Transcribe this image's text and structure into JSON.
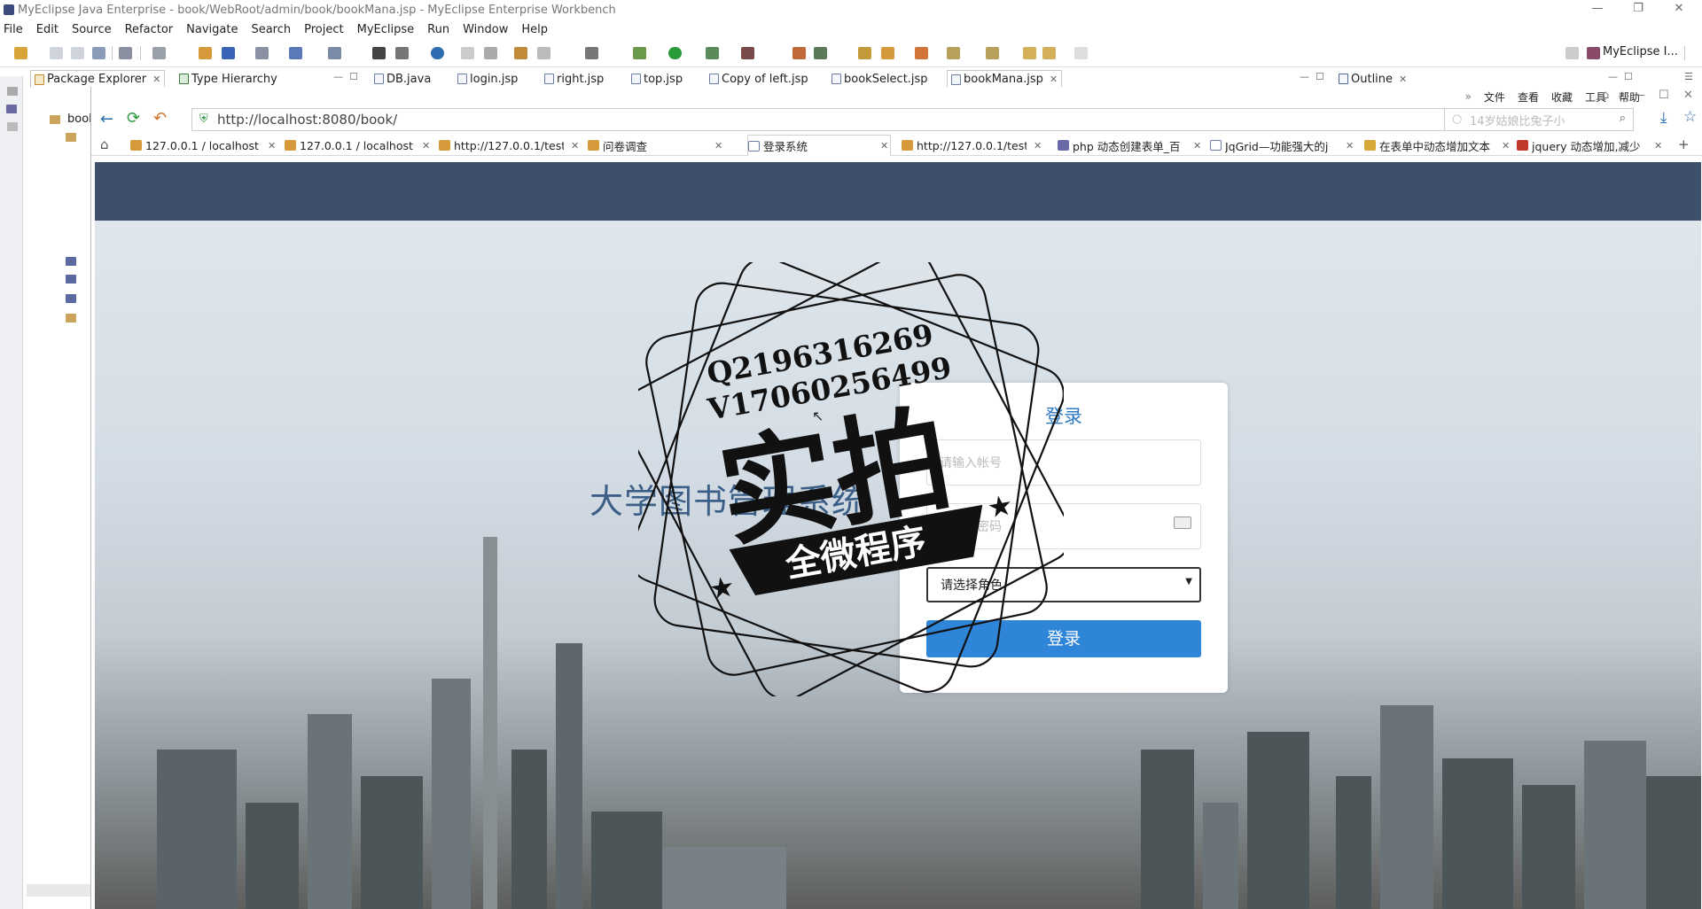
{
  "window": {
    "title": "MyEclipse Java Enterprise - book/WebRoot/admin/book/bookMana.jsp - MyEclipse Enterprise Workbench"
  },
  "menu": [
    "File",
    "Edit",
    "Source",
    "Refactor",
    "Navigate",
    "Search",
    "Project",
    "MyEclipse",
    "Run",
    "Window",
    "Help"
  ],
  "perspective_label": "MyEclipse I...",
  "view_tabs": {
    "package_explorer": "Package Explorer",
    "type_hierarchy": "Type Hierarchy",
    "outline": "Outline"
  },
  "editor_tabs": [
    "DB.java",
    "login.jsp",
    "right.jsp",
    "top.jsp",
    "Copy of left.jsp",
    "bookSelect.jsp",
    "bookMana.jsp"
  ],
  "tree_label": "book",
  "browser": {
    "menu": [
      "文件",
      "查看",
      "收藏",
      "工具",
      "帮助"
    ],
    "url": "http://localhost:8080/book/",
    "search_placeholder": "14岁姑娘比兔子小",
    "tabs": [
      "127.0.0.1 / localhost",
      "127.0.0.1 / localhost",
      "http://127.0.0.1/test",
      "问卷调查",
      "登录系统",
      "http://127.0.0.1/test",
      "php 动态创建表单_百",
      "JqGrid—功能强大的j",
      "在表单中动态增加文本",
      "jquery 动态增加,减少"
    ]
  },
  "page": {
    "system_title": "大学图书管理系统",
    "login_title": "登录",
    "account_placeholder": "请输入帐号",
    "password_placeholder": "请输入密码",
    "role_select": "请选择角色",
    "login_button": "登录"
  },
  "watermark": {
    "line1": "Q2196316269",
    "line2": "V17060256499",
    "big": "实拍",
    "banner": "全微程序"
  },
  "colors": {
    "header": "#3e4f6d",
    "login_button": "#2f86d8",
    "login_title": "#2e7bc4"
  }
}
